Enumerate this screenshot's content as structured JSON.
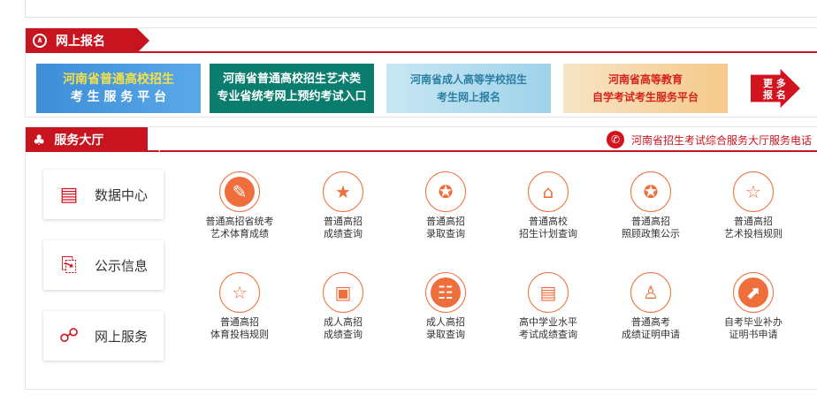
{
  "online_registration": {
    "title": "网上报名",
    "icon": "badge-icon",
    "banners": [
      {
        "line1": "河南省普通高校招生",
        "line2": "考 生 服 务 平 台"
      },
      {
        "line1": "河南省普通高校招生艺术类",
        "line2": "专业省统考网上预约考试入口"
      },
      {
        "line1": "河南省成人高等学校招生",
        "line2": "考生网上报名"
      },
      {
        "line1": "河南省高等教育",
        "line2": "自学考试考生服务平台"
      }
    ],
    "more": {
      "line1": "更 多",
      "line2": "报 名"
    }
  },
  "service_hall": {
    "title": "服务大厅",
    "icon": "people-icon",
    "hotline": "河南省招生考试综合服务大厅服务电话",
    "side_buttons": [
      {
        "label": "数据中心",
        "icon": "document-stack-icon"
      },
      {
        "label": "公示信息",
        "icon": "announcement-icon"
      },
      {
        "label": "网上服务",
        "icon": "online-service-icon"
      }
    ],
    "services": [
      {
        "line1": "普通高招省统考",
        "line2": "艺术体育成绩",
        "icon": "edit-icon"
      },
      {
        "line1": "普通高招",
        "line2": "成绩查询",
        "icon": "star-icon"
      },
      {
        "line1": "普通高招",
        "line2": "录取查询",
        "icon": "star-badge-icon"
      },
      {
        "line1": "普通高校",
        "line2": "招生计划查询",
        "icon": "building-icon"
      },
      {
        "line1": "普通高招",
        "line2": "照顾政策公示",
        "icon": "star-badge-icon"
      },
      {
        "line1": "普通高招",
        "line2": "艺术投档规则",
        "icon": "star-outline-icon"
      },
      {
        "line1": "普通高招",
        "line2": "体育投档规则",
        "icon": "star-outline-icon"
      },
      {
        "line1": "成人高招",
        "line2": "成绩查询",
        "icon": "id-card-icon"
      },
      {
        "line1": "成人高招",
        "line2": "录取查询",
        "icon": "people-board-icon"
      },
      {
        "line1": "高中学业水平",
        "line2": "考试成绩查询",
        "icon": "document-icon"
      },
      {
        "line1": "普通高考",
        "line2": "成绩证明申请",
        "icon": "teacher-icon"
      },
      {
        "line1": "自考毕业补办",
        "line2": "证明书申请",
        "icon": "certificate-icon"
      }
    ]
  },
  "colors": {
    "brand_red": "#c8141e",
    "accent_orange": "#ef6f3c"
  }
}
